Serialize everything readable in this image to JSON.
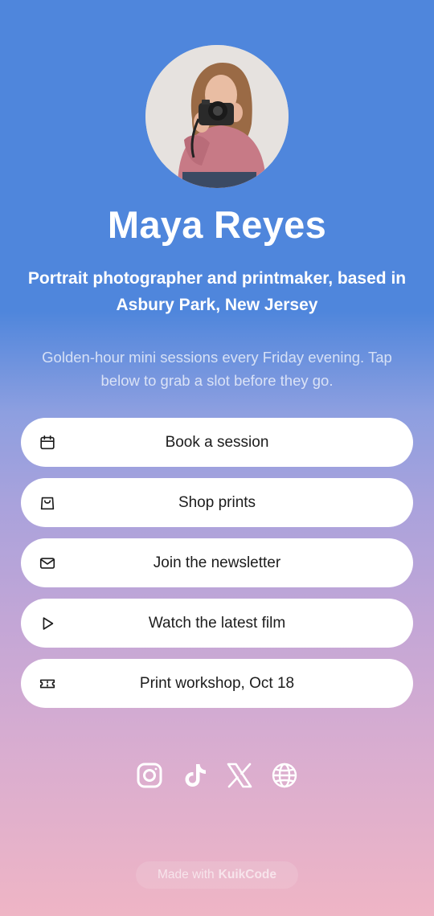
{
  "profile": {
    "name": "Maya Reyes",
    "bio": "Portrait photographer and printmaker, based in Asbury Park, New Jersey",
    "note": "Golden-hour mini sessions every Friday evening. Tap below to grab a slot before they go.",
    "avatar_icon": "profile-photo"
  },
  "links": [
    {
      "label": "Book a session",
      "icon": "calendar-icon"
    },
    {
      "label": "Shop prints",
      "icon": "shopping-bag-icon"
    },
    {
      "label": "Join the newsletter",
      "icon": "mail-icon"
    },
    {
      "label": "Watch the latest film",
      "icon": "play-icon"
    },
    {
      "label": "Print workshop, Oct 18",
      "icon": "ticket-icon"
    }
  ],
  "socials": [
    {
      "icon": "instagram-icon"
    },
    {
      "icon": "tiktok-icon"
    },
    {
      "icon": "x-icon"
    },
    {
      "icon": "globe-icon"
    }
  ],
  "footer": {
    "prefix": "Made with",
    "brand": "KuikCode"
  },
  "colors": {
    "gradient_top": "#4f86dc",
    "gradient_bottom": "#efb5c5",
    "button_bg": "#ffffff",
    "text_dark": "#1c1c1c"
  }
}
